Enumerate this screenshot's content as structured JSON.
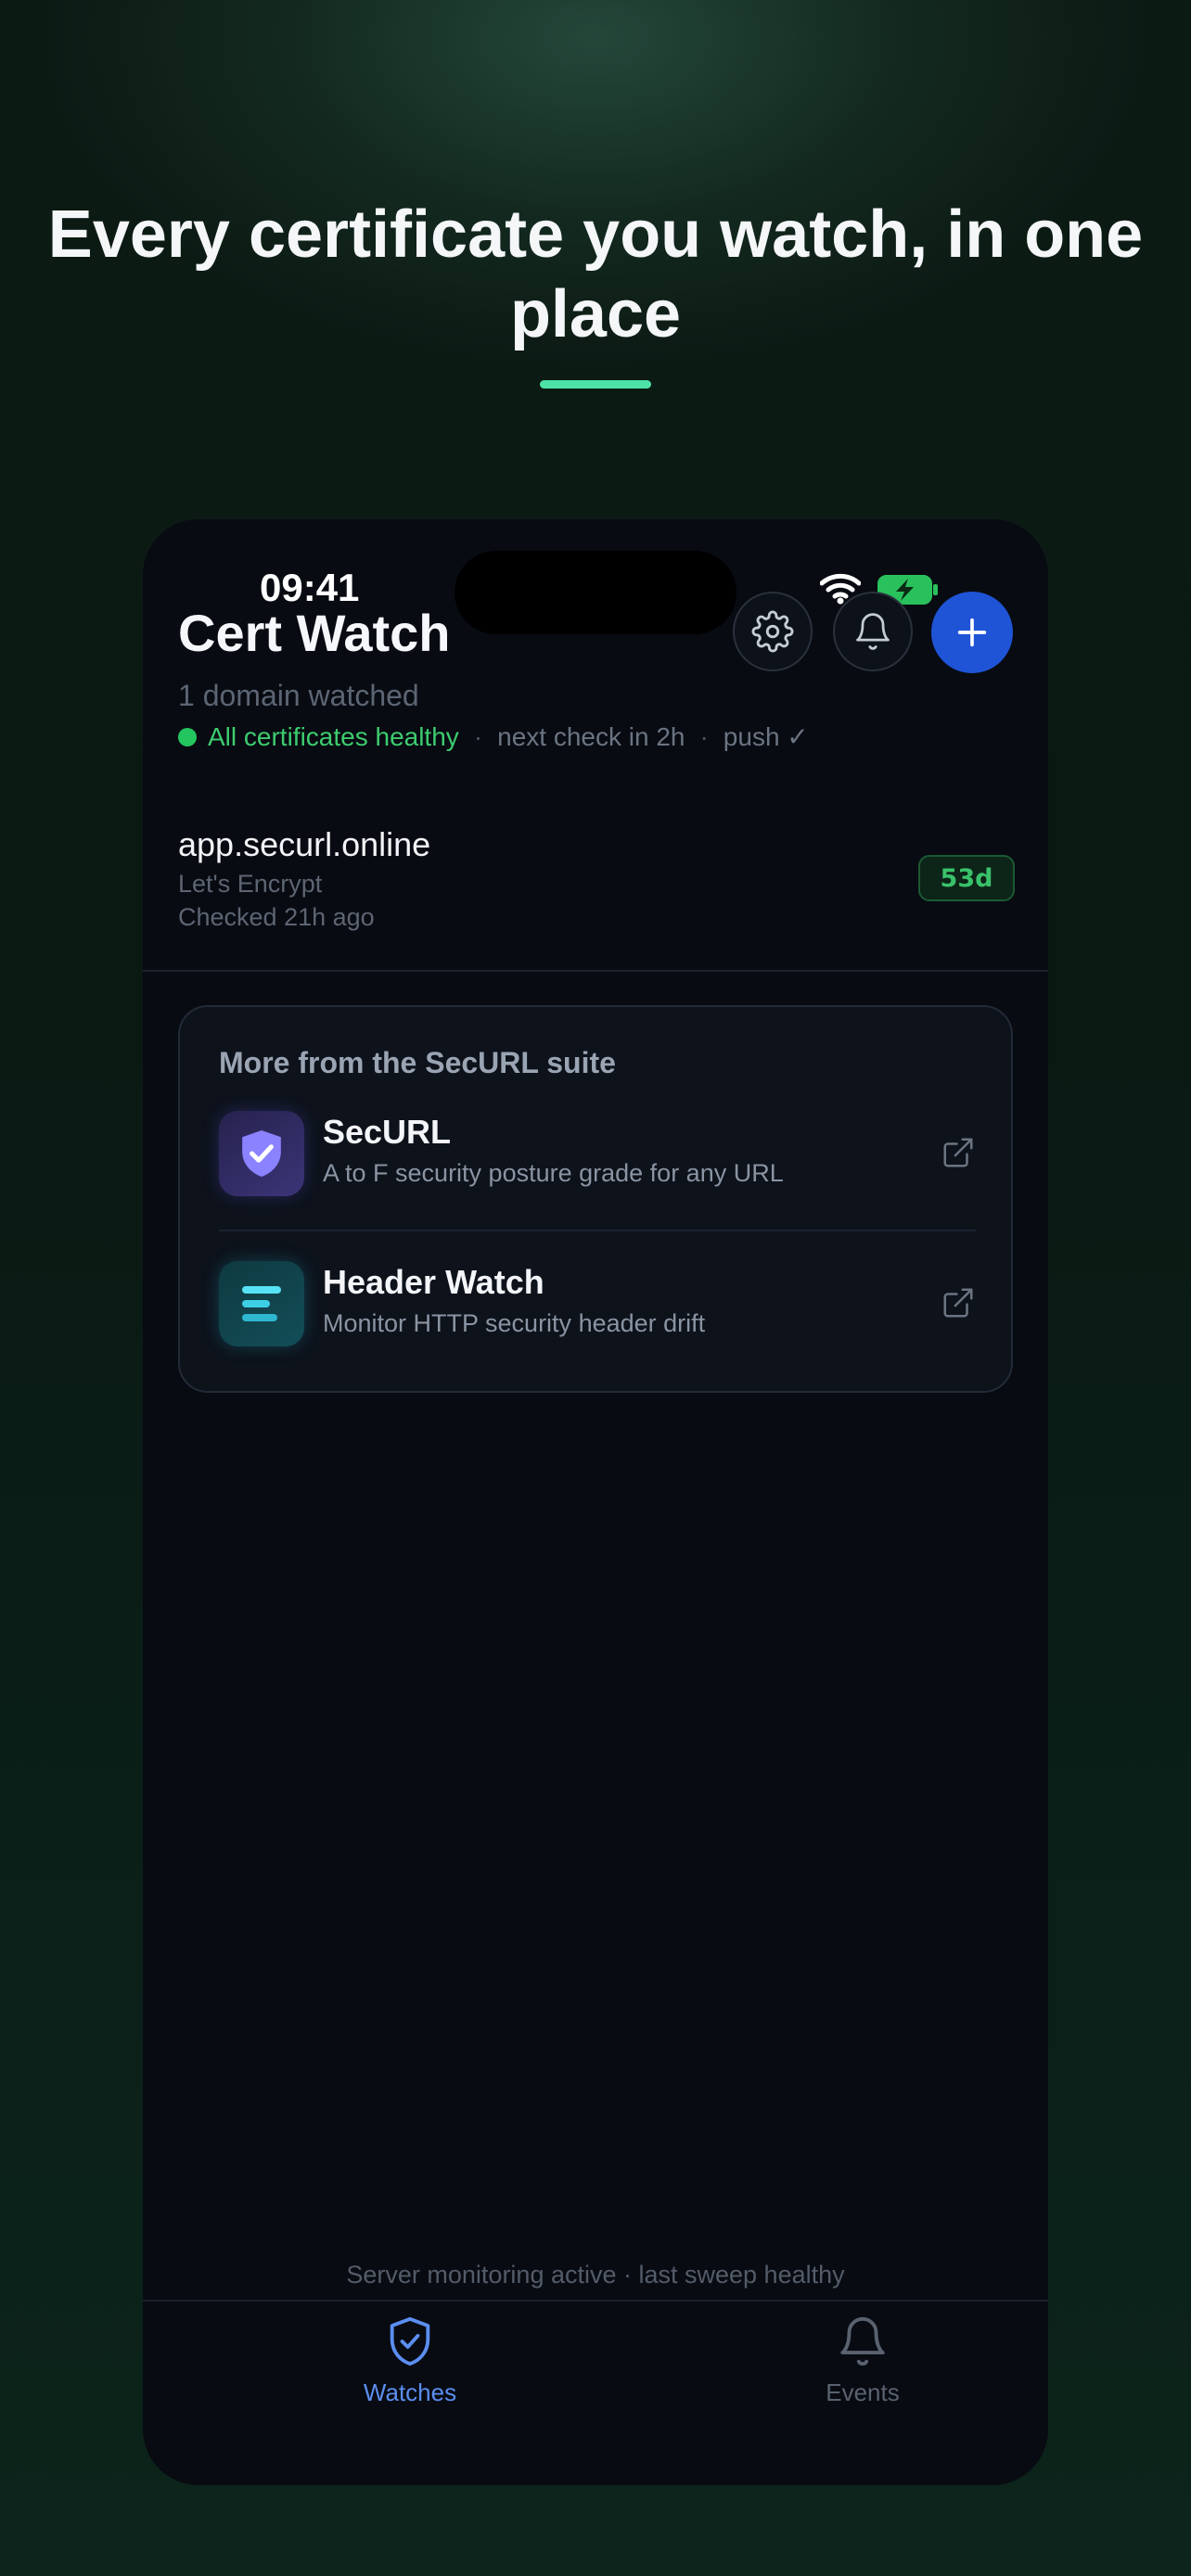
{
  "headline": "Every certificate you watch, in one place",
  "status_bar": {
    "time": "09:41"
  },
  "app": {
    "title": "Cert Watch",
    "subtitle": "1 domain watched",
    "status_ok": "All certificates healthy",
    "next_check": "next check in 2h",
    "push": "push ✓",
    "separator": "·"
  },
  "domains": [
    {
      "name": "app.securl.online",
      "issuer": "Let's Encrypt",
      "checked": "Checked 21h ago",
      "days_left": "53d"
    }
  ],
  "suite": {
    "title": "More from the SecURL suite",
    "items": [
      {
        "name": "SecURL",
        "description": "A to F security posture grade for any URL",
        "icon": "shield-check-icon"
      },
      {
        "name": "Header Watch",
        "description": "Monitor HTTP security header drift",
        "icon": "header-lines-icon"
      }
    ]
  },
  "footer_note": "Server monitoring active · last sweep healthy",
  "tabs": [
    {
      "label": "Watches",
      "icon": "shield-check-icon",
      "active": true
    },
    {
      "label": "Events",
      "icon": "bell-icon",
      "active": false
    }
  ],
  "colors": {
    "accent": "#1f54d6",
    "healthy": "#22c55e",
    "headline_underline": "#4ee3a6",
    "tab_active": "#5b8ef0"
  }
}
